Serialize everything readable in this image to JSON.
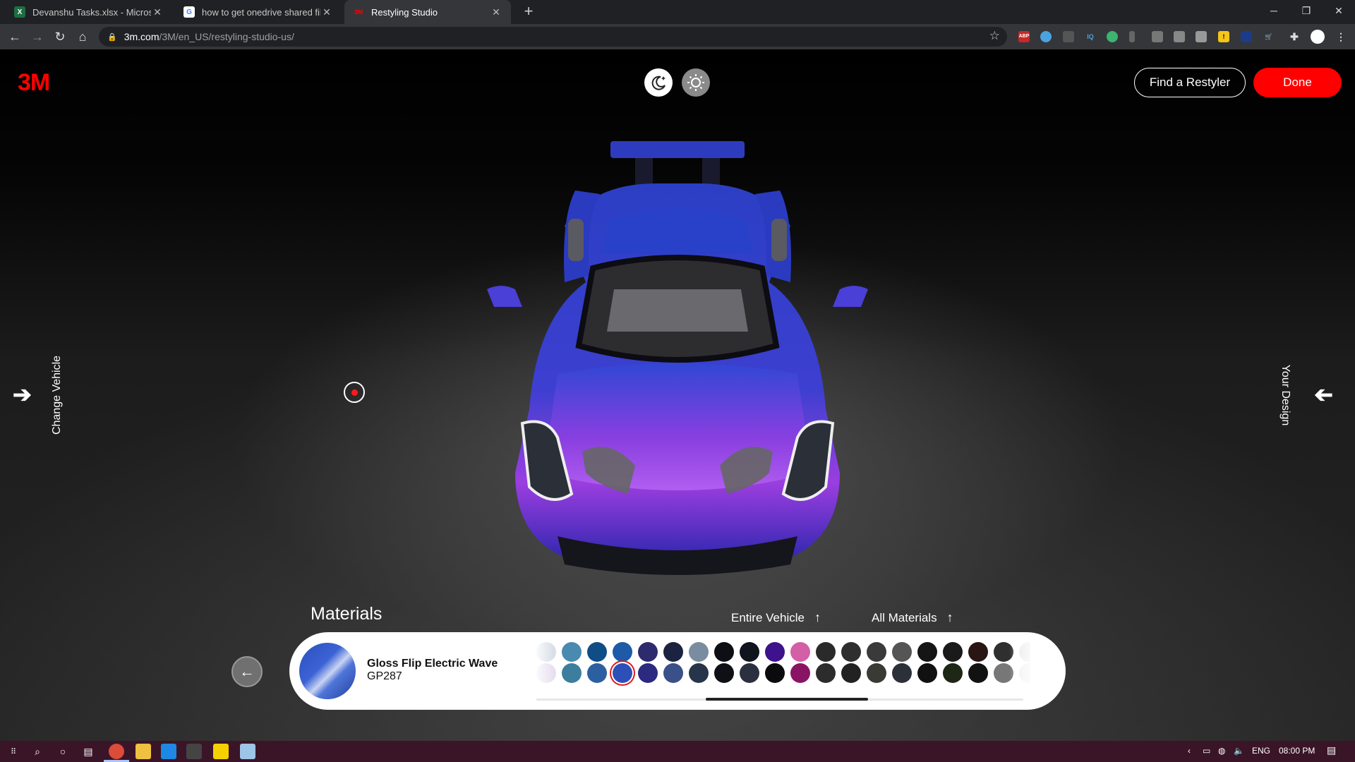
{
  "browser": {
    "tabs": [
      {
        "title": "Devanshu Tasks.xlsx - Microsoft E",
        "icon": "excel-icon",
        "active": false
      },
      {
        "title": "how to get onedrive shared files",
        "icon": "google-icon",
        "active": false
      },
      {
        "title": "Restyling Studio",
        "icon": "3m-icon",
        "active": true
      }
    ],
    "url_host": "3m.com",
    "url_path": "/3M/en_US/restyling-studio-us/"
  },
  "header": {
    "logo": "3M",
    "find_restyler": "Find a Restyler",
    "done": "Done"
  },
  "side": {
    "left_label": "Change Vehicle",
    "right_label": "Your Design"
  },
  "materials": {
    "title": "Materials",
    "filter_scope": "Entire Vehicle",
    "filter_material": "All Materials",
    "selected_name": "Gloss Flip Electric Wave",
    "selected_code": "GP287",
    "swatch_rows": [
      [
        "#d8dfe8",
        "#4a8ab0",
        "#0f4d86",
        "#1d5aa8",
        "#2e2a6e",
        "#1b2340",
        "#7a8ca0",
        "#0d0f14",
        "#10141c",
        "#3d128c",
        "#d35fa6",
        "#2a2a2a",
        "#2e2e2e",
        "#3a3a3a",
        "#555555",
        "#151515",
        "#1a1a1a",
        "#2a1515",
        "#2f2f2f",
        "#e8e8e8"
      ],
      [
        "#e8dff0",
        "#3d7e9e",
        "#2c5fa0",
        "#2c4fb8",
        "#2b2a80",
        "#3a5088",
        "#27354a",
        "#0e1016",
        "#2a3040",
        "#0b0b0e",
        "#8a1464",
        "#2c2c2c",
        "#222222",
        "#3a3a35",
        "#2c3038",
        "#111111",
        "#1e2616",
        "#121212",
        "#777777",
        "#f0f0f0"
      ]
    ],
    "selected_row": 1,
    "selected_index": 3
  },
  "taskbar": {
    "lang": "ENG",
    "time": "08:00 PM"
  }
}
